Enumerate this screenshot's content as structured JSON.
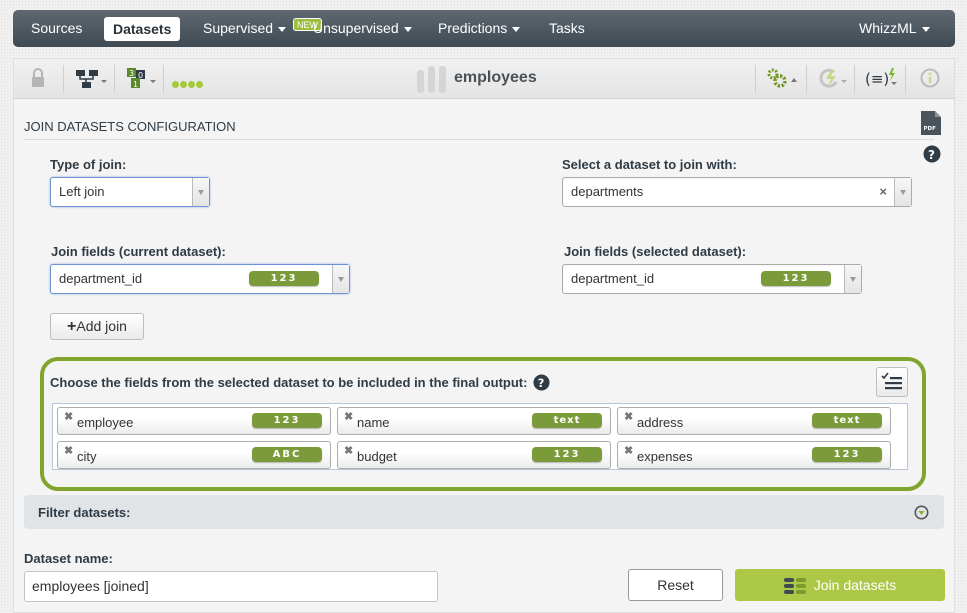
{
  "nav": {
    "items": [
      {
        "label": "Sources",
        "active": false,
        "dropdown": false
      },
      {
        "label": "Datasets",
        "active": true,
        "dropdown": false
      },
      {
        "label": "Supervised",
        "active": false,
        "dropdown": true
      },
      {
        "label": "Unsupervised",
        "active": false,
        "dropdown": true
      },
      {
        "label": "Predictions",
        "active": false,
        "dropdown": true
      },
      {
        "label": "Tasks",
        "active": false,
        "dropdown": false
      }
    ],
    "new_badge": "NEW",
    "right_menu": "WhizzML"
  },
  "toolbar": {
    "icons": [
      "lock-icon",
      "tree-icon",
      "field-types-icon",
      "progress-dots-icon",
      "gears-icon",
      "reload-icon",
      "formula-icon",
      "info-icon"
    ],
    "dataset_name": "employees"
  },
  "config": {
    "section_title": "JOIN DATASETS CONFIGURATION",
    "pdf_icon_label": "PDF",
    "type_of_join_label": "Type of join:",
    "type_of_join_value": "Left join",
    "select_dataset_label": "Select a dataset to join with:",
    "select_dataset_value": "departments",
    "join_current_label": "Join fields (current dataset):",
    "join_current_value": "department_id",
    "join_current_type": "123",
    "join_selected_label": "Join fields (selected dataset):",
    "join_selected_value": "department_id",
    "join_selected_type": "123",
    "add_join_label": "Add join"
  },
  "fields_section": {
    "title": "Choose the fields from the selected dataset to be included in the final output:",
    "fields": [
      {
        "name": "employee",
        "type": "123"
      },
      {
        "name": "name",
        "type": "text"
      },
      {
        "name": "address",
        "type": "text"
      },
      {
        "name": "city",
        "type": "ABC"
      },
      {
        "name": "budget",
        "type": "123"
      },
      {
        "name": "expenses",
        "type": "123"
      }
    ]
  },
  "filter": {
    "label": "Filter datasets:"
  },
  "dataset_name": {
    "label": "Dataset name:",
    "value": "employees [joined]"
  },
  "actions": {
    "reset_label": "Reset",
    "join_label": "Join datasets"
  },
  "colors": {
    "accent_green": "#80a42e",
    "button_green": "#adc846",
    "pill_green": "#7b9a3a",
    "nav_dark": "#4a545c"
  }
}
